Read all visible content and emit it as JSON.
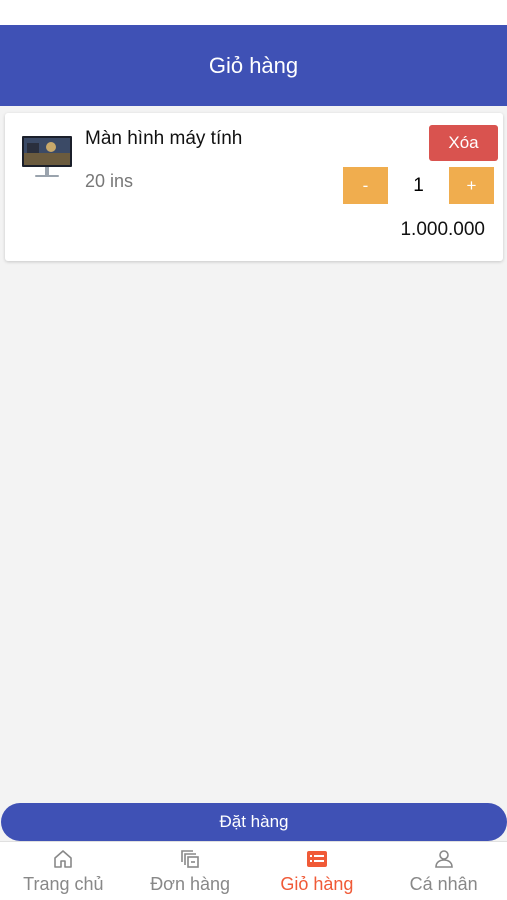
{
  "header": {
    "title": "Giỏ hàng"
  },
  "cart_items": [
    {
      "name": "Màn hình máy tính",
      "description": "20 ins",
      "quantity": "1",
      "price": "1.000.000",
      "remove_label": "Xóa",
      "decrement_label": "-",
      "increment_label": "+"
    }
  ],
  "order_button": {
    "label": "Đặt hàng"
  },
  "tabs": [
    {
      "label": "Trang chủ",
      "icon": "home-icon"
    },
    {
      "label": "Đơn hàng",
      "icon": "orders-icon"
    },
    {
      "label": "Giỏ hàng",
      "icon": "cart-icon",
      "active": true
    },
    {
      "label": "Cá nhân",
      "icon": "user-icon"
    }
  ],
  "colors": {
    "primary": "#3f51b5",
    "danger": "#d9534f",
    "warning": "#f0ad4e",
    "active_tab": "#f05a37"
  }
}
